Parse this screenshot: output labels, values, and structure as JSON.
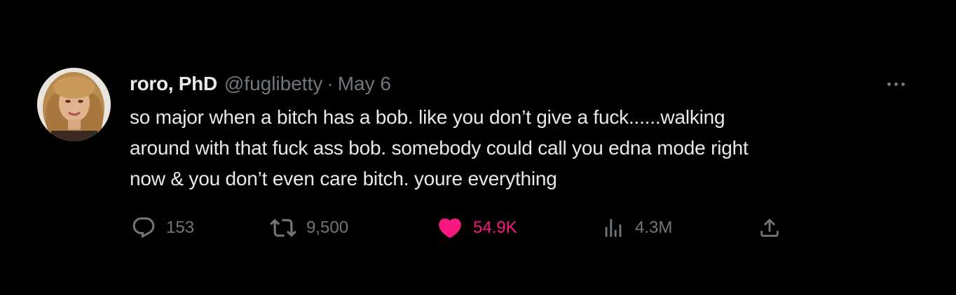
{
  "author": {
    "name": "roro, PhD",
    "handle": "@fuglibetty",
    "separator": "·",
    "date": "May 6"
  },
  "tweet": {
    "lines": [
      "so major when a bitch has a bob. like you don’t give a fuck......walking",
      "around with that fuck ass bob. somebody could call you edna mode right",
      "now & you don’t even care bitch. youre everything"
    ]
  },
  "actions": {
    "replies": "153",
    "retweets": "9,500",
    "likes": "54.9K",
    "views": "4.3M"
  },
  "icons": {
    "reply": "reply-icon",
    "retweet": "retweet-icon",
    "like": "heart-icon",
    "views": "views-icon",
    "share": "share-icon",
    "more": "more-icon"
  },
  "colors": {
    "background": "#000000",
    "text": "#e7e9ea",
    "muted": "#71767b",
    "like": "#f91880"
  }
}
